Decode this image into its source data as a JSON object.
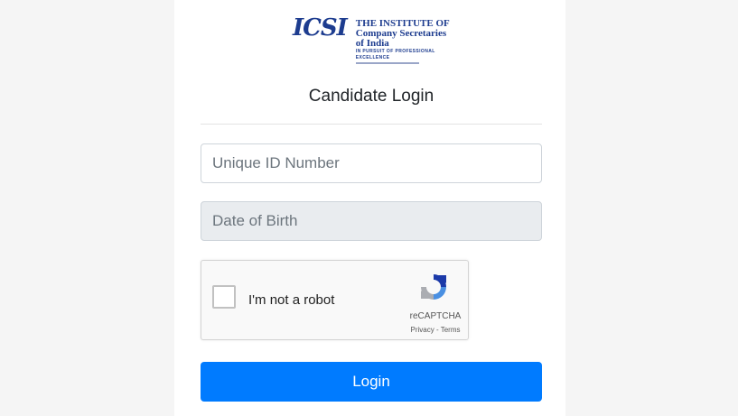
{
  "logo": {
    "mark": "ICSI",
    "line1": "THE INSTITUTE OF",
    "line2": "Company Secretaries of India",
    "line3": "IN PURSUIT OF PROFESSIONAL EXCELLENCE"
  },
  "title": "Candidate Login",
  "form": {
    "uid_placeholder": "Unique ID Number",
    "uid_value": "",
    "dob_placeholder": "Date of Birth",
    "dob_value": ""
  },
  "captcha": {
    "label": "I'm not a robot",
    "brand": "reCAPTCHA",
    "privacy": "Privacy",
    "terms": "Terms",
    "checked": false
  },
  "login_label": "Login",
  "colors": {
    "primary": "#007bff",
    "brand_blue": "#1d3c8f",
    "disabled_bg": "#e9ecef"
  }
}
